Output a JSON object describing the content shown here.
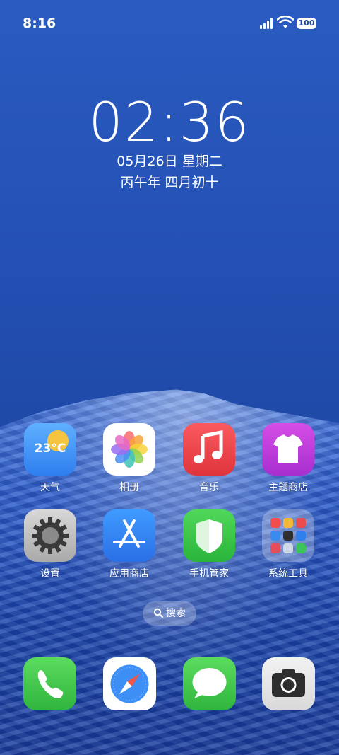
{
  "status_bar": {
    "time": "8:16",
    "battery": "100"
  },
  "lockscreen": {
    "clock": "02:36",
    "date": "05月26日 星期二",
    "lunar": "丙午年 四月初十"
  },
  "apps": [
    {
      "label": "天气",
      "temp": "23°C"
    },
    {
      "label": "相册"
    },
    {
      "label": "音乐"
    },
    {
      "label": "主题商店"
    },
    {
      "label": "设置"
    },
    {
      "label": "应用商店"
    },
    {
      "label": "手机管家"
    },
    {
      "label": "系统工具"
    }
  ],
  "search": {
    "label": "搜索"
  },
  "dock": [
    "phone-icon",
    "browser-icon",
    "messages-icon",
    "camera-icon"
  ]
}
